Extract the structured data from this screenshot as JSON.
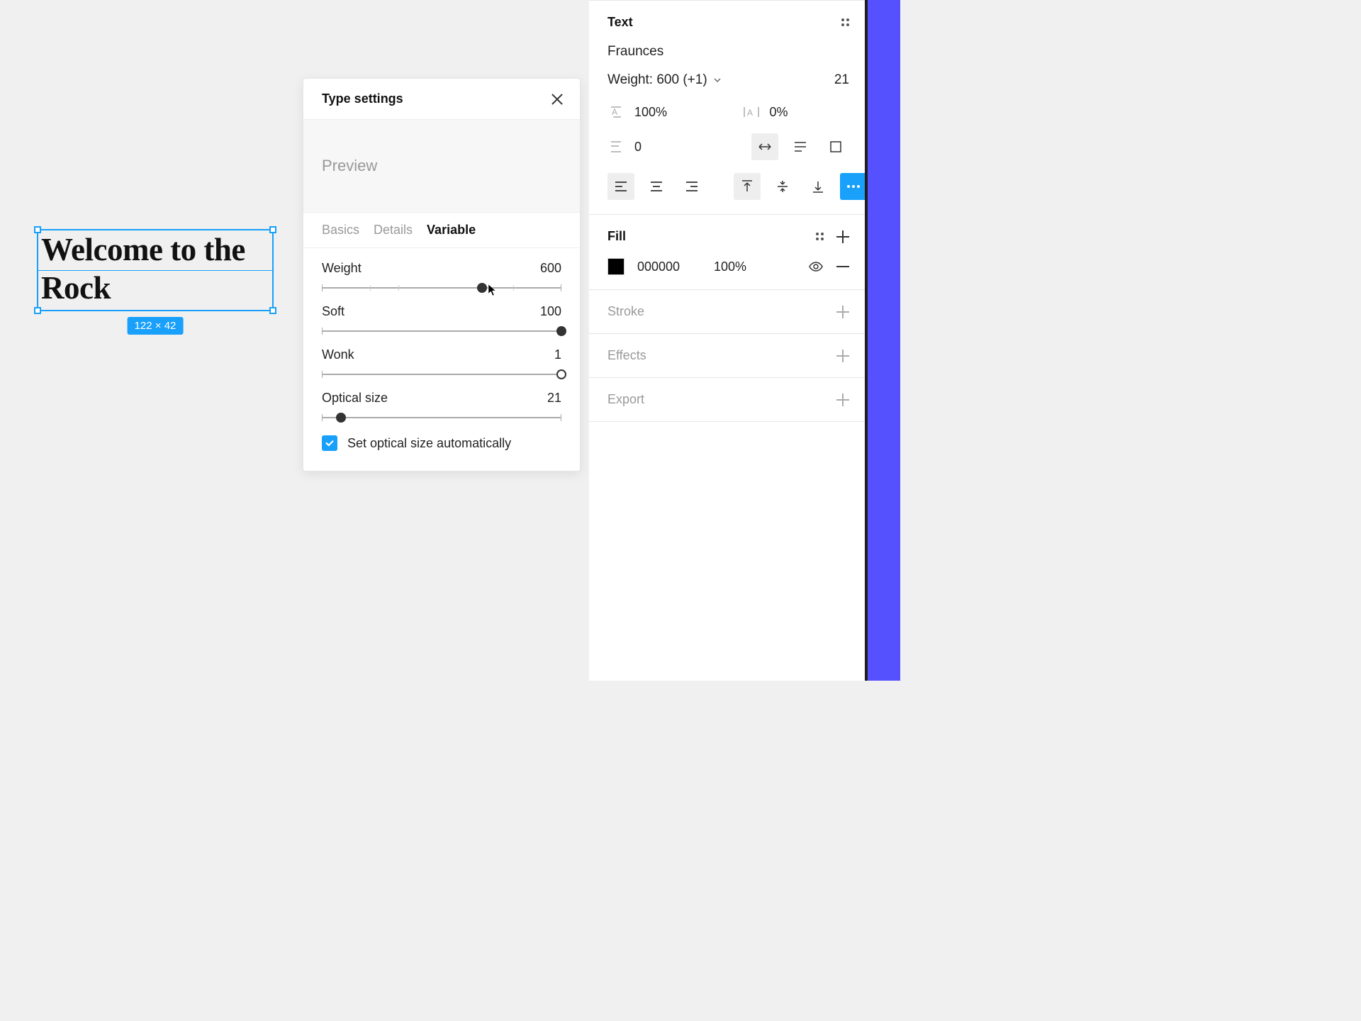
{
  "canvas": {
    "text": "Welcome to the Rock",
    "dimensions": "122 × 42"
  },
  "modal": {
    "title": "Type settings",
    "preview_label": "Preview",
    "tabs": {
      "basics": "Basics",
      "details": "Details",
      "variable": "Variable"
    },
    "sliders": {
      "weight": {
        "label": "Weight",
        "value": "600",
        "percent": 67
      },
      "soft": {
        "label": "Soft",
        "value": "100",
        "percent": 100
      },
      "wonk": {
        "label": "Wonk",
        "value": "1",
        "percent": 100
      },
      "optical": {
        "label": "Optical size",
        "value": "21",
        "percent": 8
      }
    },
    "checkbox_label": "Set optical size automatically"
  },
  "panel": {
    "text": {
      "title": "Text",
      "font": "Fraunces",
      "weight_label": "Weight: 600 (+1)",
      "size": "21",
      "line_height": "100%",
      "letter_spacing": "0%",
      "paragraph_spacing": "0"
    },
    "fill": {
      "title": "Fill",
      "hex": "000000",
      "opacity": "100%"
    },
    "stroke_title": "Stroke",
    "effects_title": "Effects",
    "export_title": "Export"
  }
}
